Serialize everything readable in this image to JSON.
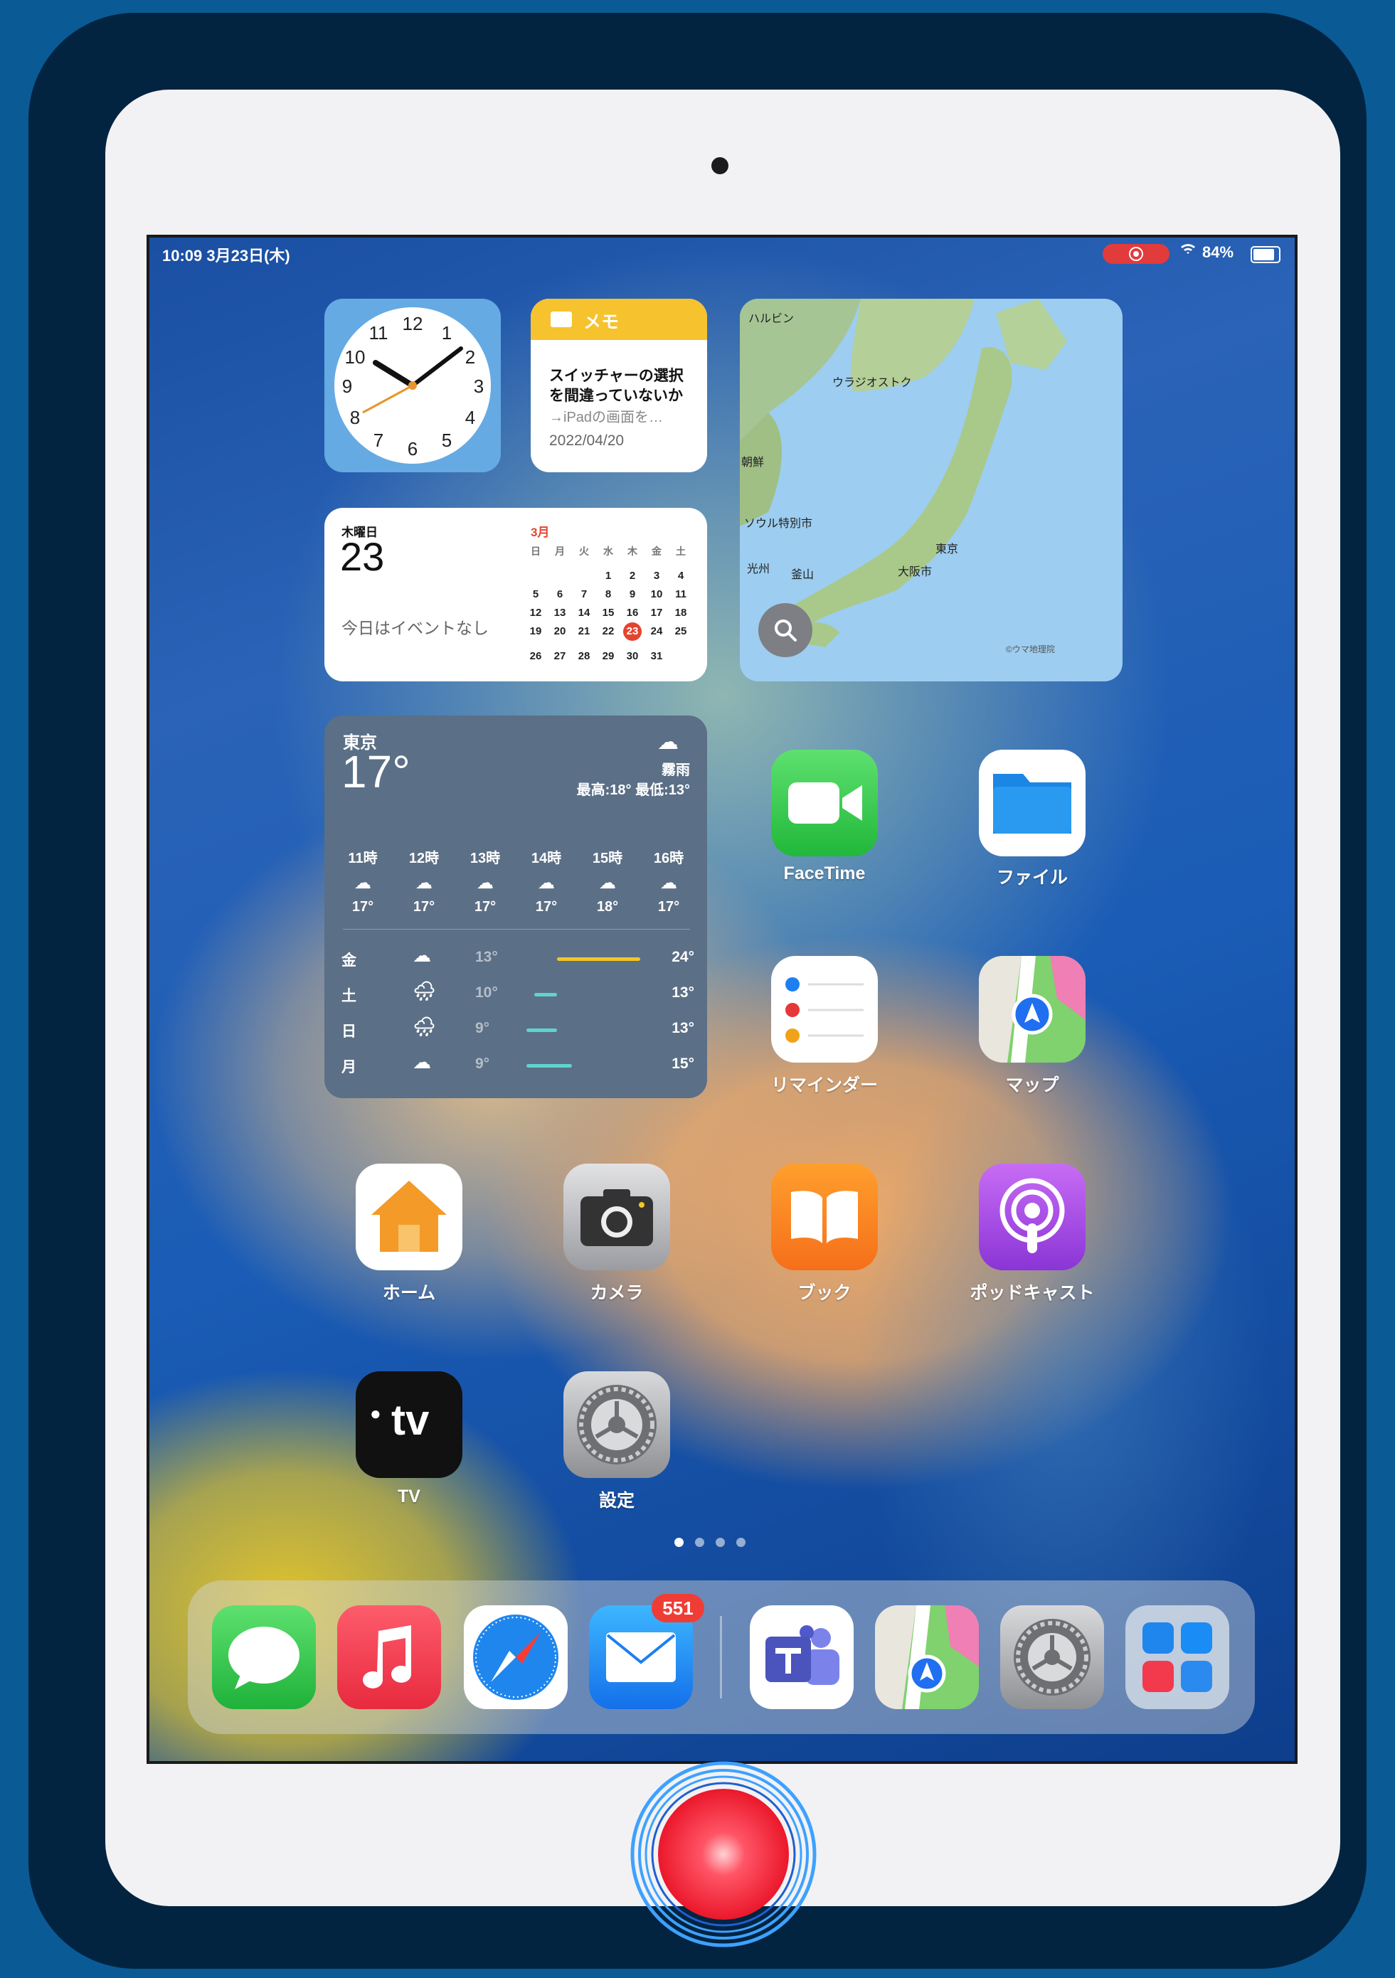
{
  "status_bar": {
    "time": "10:09 3月23日(木)",
    "battery": "84%",
    "battery_level": 0.84
  },
  "widgets": {
    "clock": {
      "numbers": [
        "12",
        "1",
        "2",
        "3",
        "4",
        "5",
        "6",
        "7",
        "8",
        "9",
        "10",
        "11"
      ]
    },
    "notes": {
      "title": "メモ",
      "line1": "スイッチャーの選択",
      "line2": "を間違っていないか",
      "line3": "→iPadの画面を…",
      "date": "2022/04/20"
    },
    "calendar": {
      "weekday": "木曜日",
      "day": "23",
      "no_events": "今日はイベントなし",
      "month": "3月",
      "week_header": [
        "日",
        "月",
        "火",
        "水",
        "木",
        "金",
        "土"
      ],
      "weeks": [
        [
          "",
          "",
          "",
          "1",
          "2",
          "3",
          "4"
        ],
        [
          "5",
          "6",
          "7",
          "8",
          "9",
          "10",
          "11"
        ],
        [
          "12",
          "13",
          "14",
          "15",
          "16",
          "17",
          "18"
        ],
        [
          "19",
          "20",
          "21",
          "22",
          "23",
          "24",
          "25"
        ],
        [
          "26",
          "27",
          "28",
          "29",
          "30",
          "31",
          ""
        ]
      ],
      "today": "23"
    },
    "map": {
      "labels": [
        "ハルビン",
        "ウラジオストク",
        "ソウル特別市",
        "東京",
        "大阪市",
        "釜山",
        "光州",
        "朝鮮"
      ],
      "credit": "©ウマ地理院"
    },
    "weather": {
      "city": "東京",
      "temp": "17°",
      "condition": "霧雨",
      "hilo": "最高:18° 最低:13°",
      "hourly": [
        {
          "time": "11時",
          "temp": "17°"
        },
        {
          "time": "12時",
          "temp": "17°"
        },
        {
          "time": "13時",
          "temp": "17°"
        },
        {
          "time": "14時",
          "temp": "17°"
        },
        {
          "time": "15時",
          "temp": "18°"
        },
        {
          "time": "16時",
          "temp": "17°"
        }
      ],
      "daily": [
        {
          "day": "金",
          "low": "13°",
          "high": "24°",
          "bar_color": "#f3c623"
        },
        {
          "day": "土",
          "low": "10°",
          "high": "13°",
          "bar_color": "#5fd3d0"
        },
        {
          "day": "日",
          "low": "9°",
          "high": "13°",
          "bar_color": "#5fd3d0"
        },
        {
          "day": "月",
          "low": "9°",
          "high": "15°",
          "bar_color": "#5fd3d0"
        }
      ]
    }
  },
  "apps": {
    "facetime": "FaceTime",
    "files": "ファイル",
    "reminders": "リマインダー",
    "maps": "マップ",
    "home": "ホーム",
    "camera": "カメラ",
    "books": "ブック",
    "podcasts": "ポッドキャスト",
    "tv": "TV",
    "tv_logo": "tv",
    "settings": "設定"
  },
  "dock": {
    "mail_badge": "551"
  },
  "page_indicator": {
    "count": 4,
    "active": 1
  }
}
